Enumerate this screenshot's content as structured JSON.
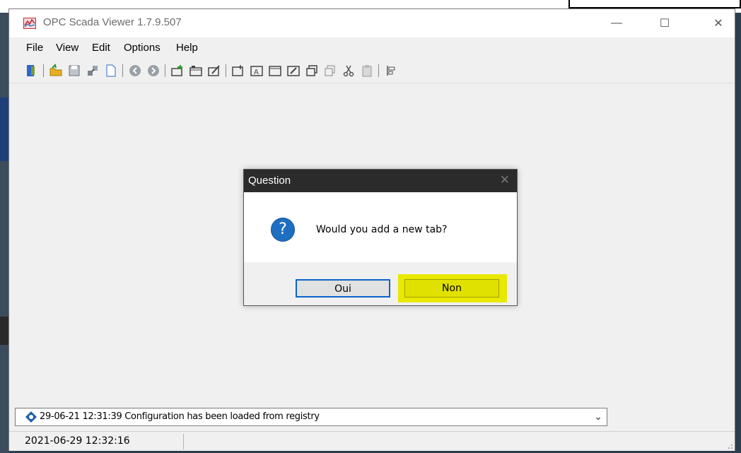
{
  "window": {
    "title": "OPC Scada Viewer 1.7.9.507",
    "controls": {
      "minimize": "—",
      "maximize": "☐",
      "close": "✕"
    }
  },
  "menu": {
    "items": [
      "File",
      "View",
      "Edit",
      "Options",
      "Help"
    ]
  },
  "toolbar": {
    "icons": [
      "exit-icon",
      "open-folder-icon",
      "save-icon",
      "connect-icon",
      "new-document-icon",
      "back-icon",
      "forward-icon",
      "add-tab-icon",
      "tab-icon",
      "edit-tab-icon",
      "new-panel-icon",
      "panel-text-icon",
      "panel-icon",
      "edit-panel-icon",
      "copy-icon",
      "paste-icon",
      "cut-icon",
      "clipboard-icon",
      "align-icon"
    ]
  },
  "dialog": {
    "title": "Question",
    "close": "✕",
    "icon": "question-icon",
    "message": "Would you add a new tab?",
    "buttons": {
      "yes": "Oui",
      "no": "Non"
    },
    "highlight_color": "#e8e800"
  },
  "log": {
    "selected": "29-06-21 12:31:39 Configuration has been loaded from registry",
    "arrow": "⌄"
  },
  "status": {
    "datetime": "2021-06-29 12:32:16"
  },
  "colors": {
    "dialog_titlebar": "#2b2b2b",
    "question_blue": "#1e6fc2",
    "focus_border": "#0a64c8"
  }
}
